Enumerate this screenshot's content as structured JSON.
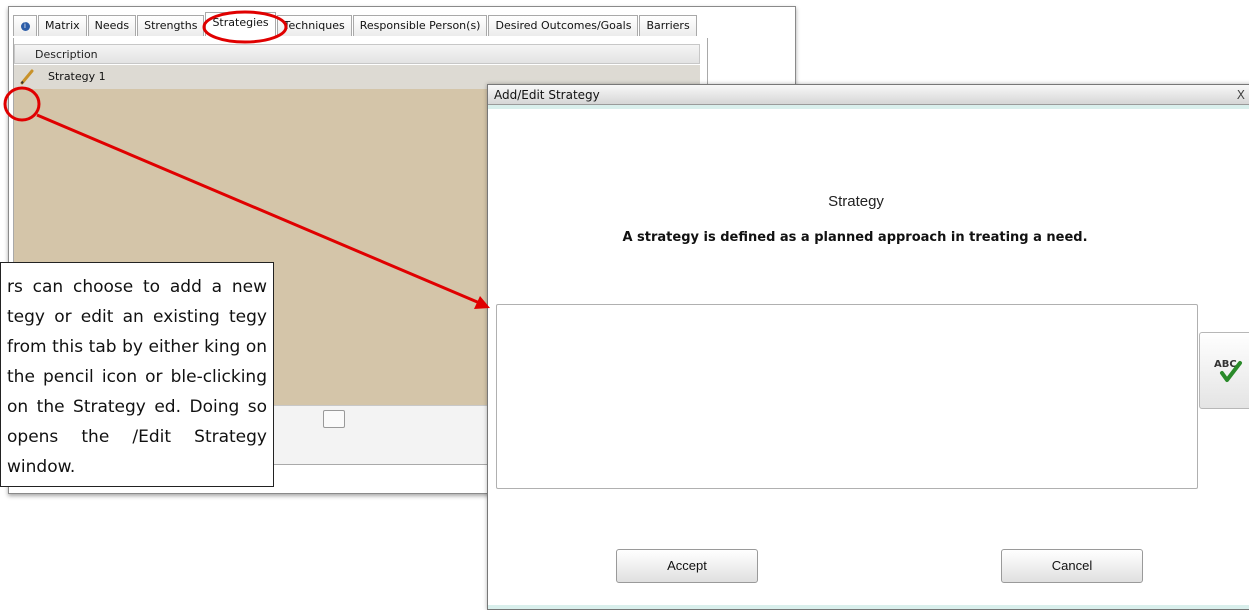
{
  "app": {
    "tabs": [
      "Matrix",
      "Needs",
      "Strengths",
      "Strategies",
      "Techniques",
      "Responsible Person(s)",
      "Desired Outcomes/Goals",
      "Barriers"
    ],
    "active_tab": "Strategies",
    "grid": {
      "column_header": "Description",
      "rows": [
        "Strategy 1"
      ]
    }
  },
  "dialog": {
    "title": "Add/Edit Strategy",
    "close_label": "X",
    "heading": "Strategy",
    "description": "A strategy is defined as a planned approach in treating a need.",
    "text_value": "",
    "spell_check_icon": "abc-spellcheck-icon",
    "accept_label": "Accept",
    "cancel_label": "Cancel"
  },
  "callout": {
    "text": "rs can choose to add a new tegy or edit an existing tegy from this tab by either king on the pencil icon or ble-clicking on the Strategy ed. Doing so opens the /Edit Strategy window."
  },
  "colors": {
    "annotation": "#e00000",
    "grid_body": "#d4c5a9",
    "dialog_band": "#d9efec"
  }
}
